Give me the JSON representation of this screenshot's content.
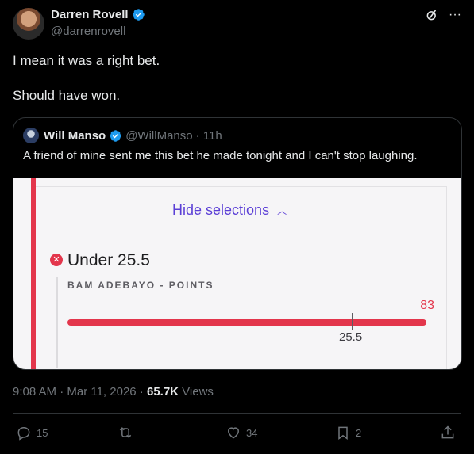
{
  "author": {
    "name": "Darren Rovell",
    "handle": "@darrenrovell"
  },
  "tweet": {
    "line1": "I mean it was a right bet.",
    "line2": "Should have won."
  },
  "quote": {
    "name": "Will Manso",
    "handle": "@WillManso",
    "time": "· 11h",
    "text": "A friend of mine sent me this bet he made tonight and I can't stop laughing."
  },
  "bet": {
    "hide_label": "Hide selections",
    "selection": "Under 25.5",
    "player": "BAM ADEBAYO - POINTS",
    "actual": "83",
    "line": "25.5",
    "progress_fraction": 1.0
  },
  "meta": {
    "time": "9:08 AM · Mar 11, 2026 · ",
    "views": "65.7K",
    "views_label": " Views"
  },
  "actions": {
    "replies": "15",
    "likes": "34",
    "bookmarks": "2"
  },
  "colors": {
    "accent_red": "#e3364c",
    "link_purple": "#5b3fd6",
    "verified_blue": "#1d9bf0"
  }
}
